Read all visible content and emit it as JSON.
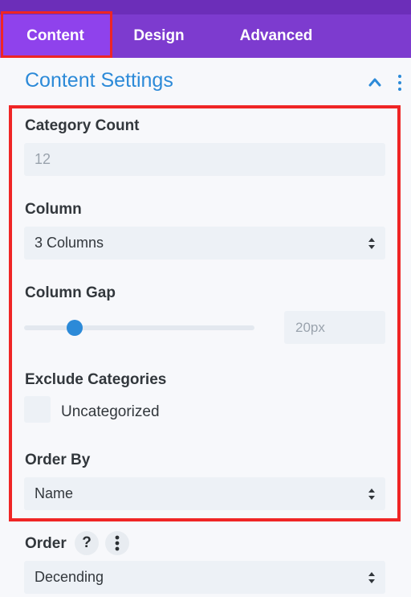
{
  "tabs": [
    {
      "label": "Content",
      "active": true
    },
    {
      "label": "Design",
      "active": false
    },
    {
      "label": "Advanced",
      "active": false
    }
  ],
  "section": {
    "title": "Content Settings"
  },
  "fields": {
    "category_count": {
      "label": "Category Count",
      "placeholder": "12"
    },
    "column": {
      "label": "Column",
      "value": "3 Columns"
    },
    "column_gap": {
      "label": "Column Gap",
      "value": "20px",
      "slider_fraction": 0.22
    },
    "exclude_categories": {
      "label": "Exclude Categories",
      "options": [
        {
          "label": "Uncategorized",
          "checked": false
        }
      ]
    },
    "order_by": {
      "label": "Order By",
      "value": "Name"
    },
    "order": {
      "label": "Order",
      "help_icon": "?",
      "value": "Decending"
    }
  },
  "colors": {
    "tab_bar": "#7d3bcf",
    "active_tab": "#8f42ec",
    "accent": "#2c8ad8",
    "highlight": "#ef2525"
  }
}
